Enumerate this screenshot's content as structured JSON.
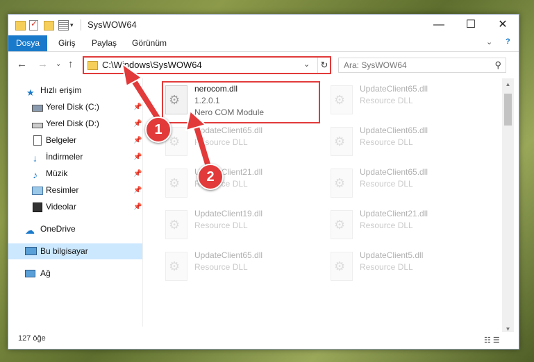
{
  "window": {
    "title": "SysWOW64",
    "min_glyph": "—",
    "max_glyph": "☐",
    "close_glyph": "✕",
    "qa_dropdown": "▾"
  },
  "menu": {
    "file": "Dosya",
    "home": "Giriş",
    "share": "Paylaş",
    "view": "Görünüm",
    "expand_glyph": "⌄",
    "help_glyph": "?"
  },
  "nav": {
    "back": "←",
    "forward": "→",
    "recent": "⌄",
    "up": "↑"
  },
  "address": {
    "path": "C:\\Windows\\SysWOW64",
    "dropdown": "⌄",
    "refresh": "↻"
  },
  "search": {
    "placeholder": "Ara: SysWOW64",
    "icon": "⚲"
  },
  "sidebar": {
    "pin_glyph": "📌",
    "items": [
      {
        "label": "Hızlı erişim",
        "icon": "star-icon"
      },
      {
        "label": "Yerel Disk (C:)",
        "icon": "drive-icon"
      },
      {
        "label": "Yerel Disk (D:)",
        "icon": "drive-icon"
      },
      {
        "label": "Belgeler",
        "icon": "documents-icon"
      },
      {
        "label": "İndirmeler",
        "icon": "download-icon"
      },
      {
        "label": "Müzik",
        "icon": "music-icon"
      },
      {
        "label": "Resimler",
        "icon": "pictures-icon"
      },
      {
        "label": "Videolar",
        "icon": "video-icon"
      },
      {
        "label": "OneDrive",
        "icon": "cloud-icon"
      },
      {
        "label": "Bu bilgisayar",
        "icon": "computer-icon"
      },
      {
        "label": "Ağ",
        "icon": "network-icon"
      }
    ]
  },
  "files": [
    {
      "name": "nerocom.dll",
      "type": "1.2.0.1",
      "desc": "Nero COM Module"
    },
    {
      "name": "UpdateClient65.dll",
      "type": "Resource DLL"
    },
    {
      "name": "UpdateClient65.dll",
      "type": "Resource DLL"
    },
    {
      "name": "UpdateClient65.dll",
      "type": "Resource DLL"
    },
    {
      "name": "UpdateClient21.dll",
      "type": "Resource DLL"
    },
    {
      "name": "UpdateClient65.dll",
      "type": "Resource DLL"
    },
    {
      "name": "UpdateClient19.dll",
      "type": "Resource DLL"
    },
    {
      "name": "UpdateClient21.dll",
      "type": "Resource DLL"
    },
    {
      "name": "UpdateClient65.dll",
      "type": "Resource DLL"
    },
    {
      "name": "UpdateClient5.dll",
      "type": "Resource DLL"
    }
  ],
  "status": {
    "count": "127 öğe",
    "view_glyphs": "☷ ☰"
  },
  "scroll": {
    "up": "▲",
    "down": "▼"
  },
  "markers": {
    "one": "1",
    "two": "2"
  },
  "colors": {
    "accent": "#1979ca",
    "highlight": "#e23a3a",
    "selection": "#cce8ff"
  }
}
